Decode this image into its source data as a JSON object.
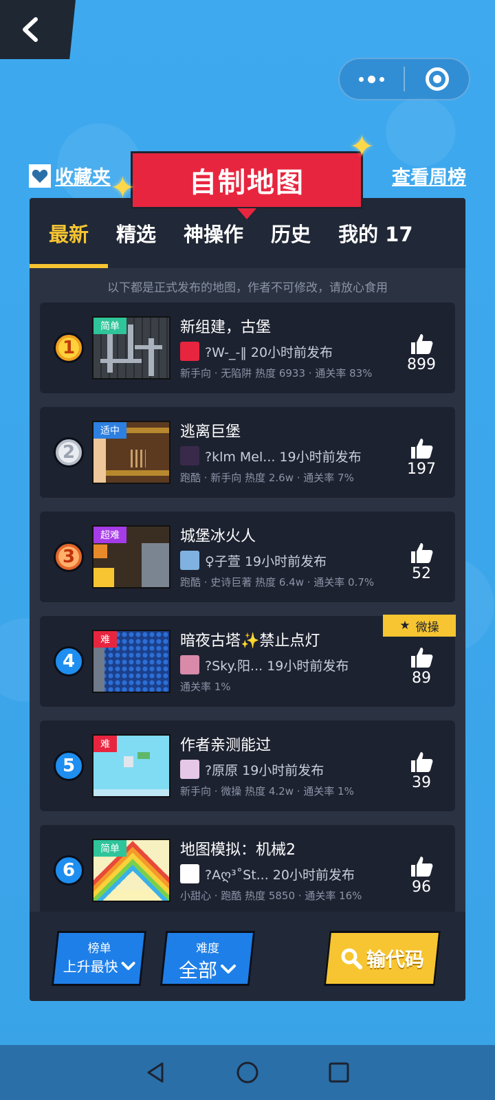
{
  "header": {
    "favorites_label": "收藏夹",
    "title": "自制地图",
    "weekly_label": "查看周榜"
  },
  "tabs": [
    {
      "label": "最新",
      "active": true
    },
    {
      "label": "精选"
    },
    {
      "label": "神操作"
    },
    {
      "label": "历史"
    },
    {
      "label": "我的 17"
    }
  ],
  "notice": "以下都是正式发布的地图，作者不可修改，请放心食用",
  "maps": [
    {
      "rank": "1",
      "badge": "简单",
      "badge_color": "#2fc49a",
      "name": "新组建，古堡",
      "author": "?W-_-‖ 20小时前发布",
      "meta": "新手向 · 无陷阱 热度 6933 · 通关率 83%",
      "likes": "899",
      "theme": "castle"
    },
    {
      "rank": "2",
      "badge": "适中",
      "badge_color": "#2d7fe0",
      "name": "逃离巨堡",
      "author": "?klm Mel... 19小时前发布",
      "meta": "跑酷 · 新手向 热度 2.6w · 通关率 7%",
      "likes": "197",
      "theme": "brown"
    },
    {
      "rank": "3",
      "badge": "超难",
      "badge_color": "#a63be8",
      "name": "城堡冰火人",
      "author": "♀子萱 19小时前发布",
      "meta": "跑酷 · 史诗巨著 热度 6.4w · 通关率 0.7%",
      "likes": "52",
      "theme": "dark"
    },
    {
      "rank": "4",
      "badge": "难",
      "badge_color": "#e8253f",
      "name": "暗夜古塔✨禁止点灯",
      "author": "?Sky.阳... 19小时前发布",
      "meta": "通关率 1%",
      "likes": "89",
      "theme": "blue",
      "tag": "微操"
    },
    {
      "rank": "5",
      "badge": "难",
      "badge_color": "#e8253f",
      "name": "作者亲测能过",
      "author": "?原原 19小时前发布",
      "meta": "新手向 · 微操 热度 4.2w · 通关率 1%",
      "likes": "39",
      "theme": "sky"
    },
    {
      "rank": "6",
      "badge": "简单",
      "badge_color": "#2fc49a",
      "name": "地图模拟：机械2",
      "author": "?Aღ³˚St... 20小时前发布",
      "meta": "小甜心 · 跑酷 热度 5850 · 通关率 16%",
      "likes": "96",
      "theme": "rainbow"
    }
  ],
  "bottom": {
    "rank_small": "榜单",
    "rank_big": "上升最快",
    "diff_small": "难度",
    "diff_big": "全部",
    "code_label": "输代码"
  }
}
